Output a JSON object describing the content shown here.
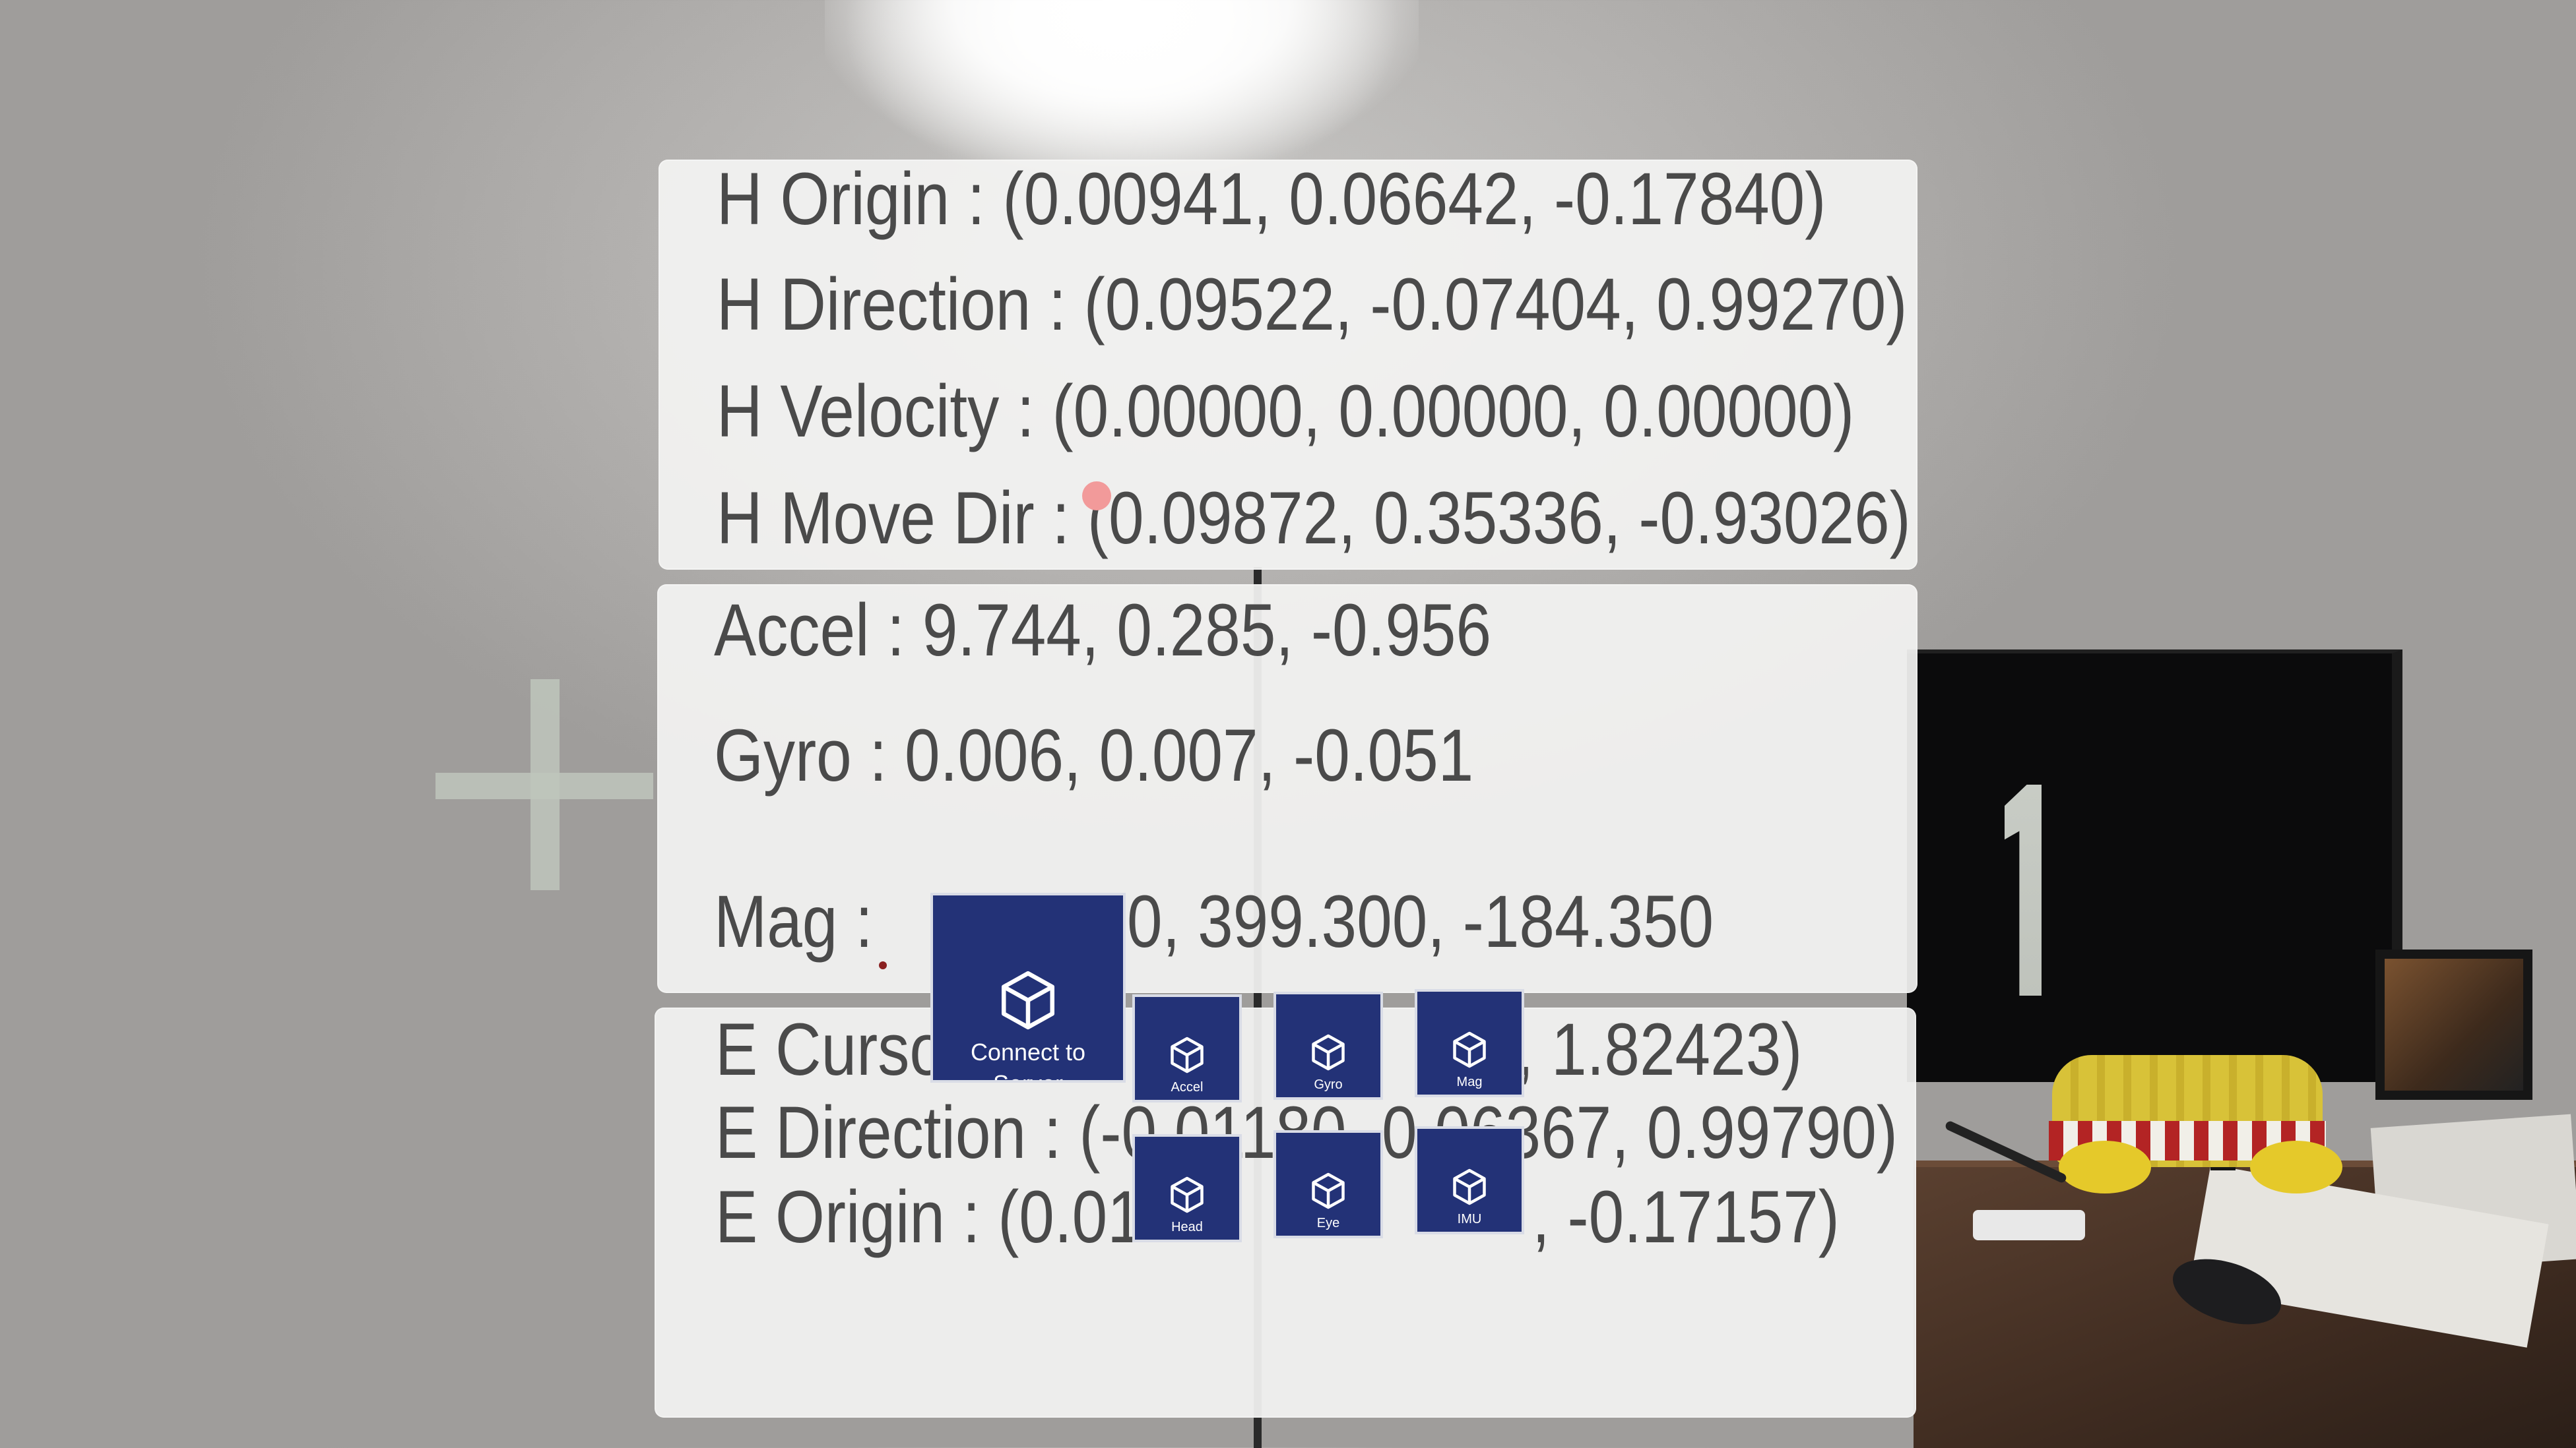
{
  "head_panel": {
    "origin": "H Origin : (0.00941, 0.06642, -0.17840)",
    "direction": "H Direction : (0.09522, -0.07404, 0.99270)",
    "velocity": "H Velocity : (0.00000, 0.00000, 0.00000)",
    "move_dir": "H Move Dir : (0.09872, 0.35336, -0.93026)"
  },
  "imu_panel": {
    "accel": "Accel : 9.744, 0.285, -0.956",
    "gyro": "Gyro  : 0.006, 0.007, -0.051",
    "mag_label": "Mag  :",
    "mag_value": "0, 399.300, -184.350"
  },
  "eye_panel": {
    "cursor_label": "E Curso",
    "cursor_value": "8, 1.82423)",
    "direction": "E Direction : (-0.01180, 0.06367, 0.99790)",
    "origin_label": "E Origin : (0.01",
    "origin_value": ", -0.17157)"
  },
  "buttons": {
    "connect": "Connect to Server",
    "accel": "Accel",
    "gyro": "Gyro",
    "mag": "Mag",
    "head": "Head",
    "eye": "Eye",
    "imu": "IMU"
  },
  "background": {
    "monitor_glyph": "1"
  },
  "colors": {
    "button_bg": "#233277",
    "panel_bg": "#f3f3f2",
    "text": "#4a4a4a",
    "pointer": "#f29a9a"
  }
}
